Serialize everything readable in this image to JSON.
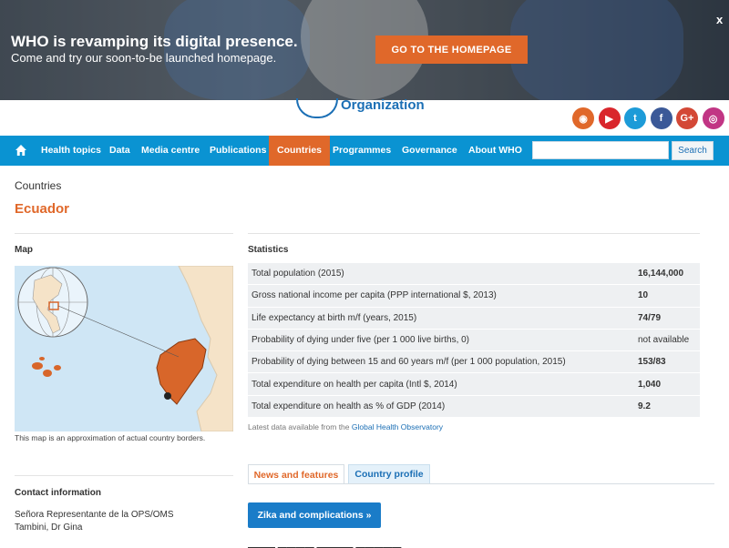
{
  "banner": {
    "title": "WHO is revamping its digital presence.",
    "subtitle": "Come and try our soon-to-be launched homepage.",
    "cta": "GO TO THE HOMEPAGE",
    "close": "x"
  },
  "header": {
    "logo_text": "Organization",
    "social_icons": [
      {
        "name": "rss-icon",
        "glyph": "◉",
        "color": "#e0682a"
      },
      {
        "name": "youtube-icon",
        "glyph": "▶",
        "color": "#d9262c"
      },
      {
        "name": "twitter-icon",
        "glyph": "t",
        "color": "#1d9bd8"
      },
      {
        "name": "facebook-icon",
        "glyph": "f",
        "color": "#3b5998"
      },
      {
        "name": "googleplus-icon",
        "glyph": "G+",
        "color": "#d34836"
      },
      {
        "name": "instagram-icon",
        "glyph": "◎",
        "color": "#c13584"
      }
    ]
  },
  "nav": {
    "home_icon": "home-icon",
    "items": [
      "Health topics",
      "Data",
      "Media centre",
      "Publications",
      "Countries",
      "Programmes",
      "Governance",
      "About WHO"
    ],
    "active": "Countries",
    "search_placeholder": "",
    "search_button": "Search"
  },
  "breadcrumb": "Countries",
  "page_title": "Ecuador",
  "map": {
    "heading": "Map",
    "caption": "This map is an approximation of actual country borders."
  },
  "statistics": {
    "heading": "Statistics",
    "rows": [
      {
        "label": "Total population (2015)",
        "value": "16,144,000"
      },
      {
        "label": "Gross national income per capita (PPP international $, 2013)",
        "value": "10"
      },
      {
        "label": "Life expectancy at birth m/f (years, 2015)",
        "value": "74/79"
      },
      {
        "label": "Probability of dying under five (per 1 000 live births, 0)",
        "value": "not available"
      },
      {
        "label": "Probability of dying between 15 and 60 years m/f (per 1 000 population, 2015)",
        "value": "153/83"
      },
      {
        "label": "Total expenditure on health per capita (Intl $, 2014)",
        "value": "1,040"
      },
      {
        "label": "Total expenditure on health as % of GDP (2014)",
        "value": "9.2"
      }
    ],
    "latest_prefix": "Latest data available from the",
    "latest_link": "Global Health Observatory"
  },
  "tabs": [
    "News and features",
    "Country profile"
  ],
  "feature_button": "Zika and complications »",
  "contact": {
    "heading": "Contact information",
    "line1": "Señora Representante de la OPS/OMS",
    "line2": "Tambini, Dr Gina"
  },
  "colors": {
    "accent": "#e0682a",
    "nav": "#0a93d2",
    "link": "#1b6fb5"
  }
}
